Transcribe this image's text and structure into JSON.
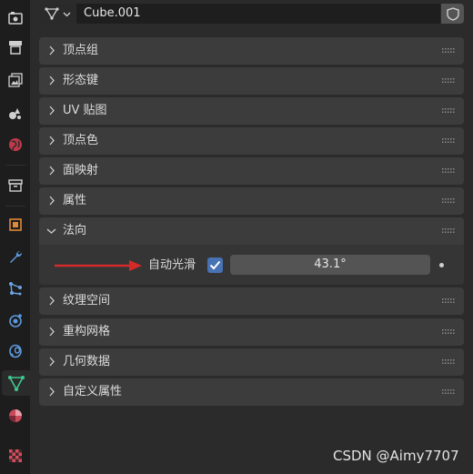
{
  "header": {
    "object_name": "Cube.001"
  },
  "sidebar": {
    "tabs": [
      {
        "name": "render-icon",
        "active": false
      },
      {
        "name": "output-icon",
        "active": false
      },
      {
        "name": "view-layer-icon",
        "active": false
      },
      {
        "name": "scene-icon",
        "active": false
      },
      {
        "name": "world-icon",
        "active": false
      },
      {
        "name": "collection-icon",
        "active": false
      },
      {
        "name": "object-icon",
        "active": false
      },
      {
        "name": "modifier-icon",
        "active": false
      },
      {
        "name": "particles-icon",
        "active": false
      },
      {
        "name": "physics-icon",
        "active": false
      },
      {
        "name": "constraints-icon",
        "active": false
      },
      {
        "name": "data-icon",
        "active": true
      },
      {
        "name": "material-icon",
        "active": false
      },
      {
        "name": "texture-icon",
        "active": false
      }
    ]
  },
  "panels": {
    "vertex_groups": "顶点组",
    "shape_keys": "形态键",
    "uv_maps": "UV 贴图",
    "color_attributes": "顶点色",
    "face_maps": "面映射",
    "attributes": "属性",
    "normals": "法向",
    "texture_space": "纹理空间",
    "remesh": "重构网格",
    "geometry_data": "几何数据",
    "custom_properties": "自定义属性"
  },
  "normals": {
    "auto_smooth_label": "自动光滑",
    "auto_smooth_checked": true,
    "angle_value": "43.1°"
  },
  "colors": {
    "accent": "#4772b3",
    "arrow": "#d42a2a",
    "data_tab": "#3ec88f"
  },
  "watermark": "CSDN @Aimy7707"
}
